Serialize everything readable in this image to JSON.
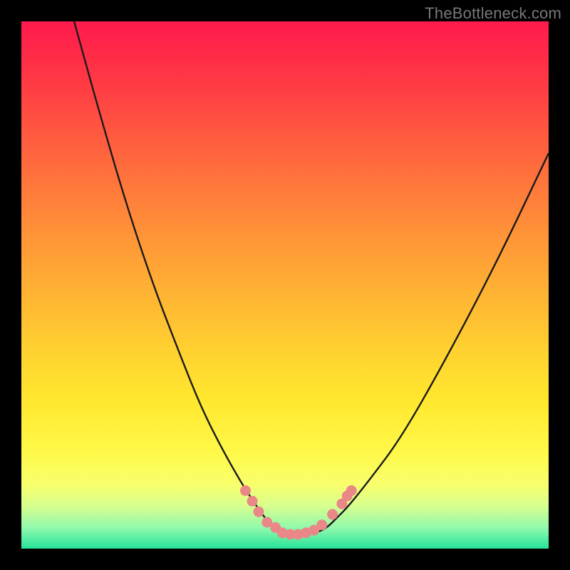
{
  "watermark": "TheBottleneck.com",
  "colors": {
    "frame": "#000000",
    "curve_stroke": "#1a1a1a",
    "marker_fill": "#e98886",
    "gradient_top": "#ff1a4d",
    "gradient_bottom": "#25e49a"
  },
  "chart_data": {
    "type": "line",
    "title": "",
    "xlabel": "",
    "ylabel": "",
    "xlim": [
      0,
      100
    ],
    "ylim": [
      0,
      100
    ],
    "grid": false,
    "legend": false,
    "note": "Y axis is inverted visually (0 at top, 100 at bottom). Values below are data-space y where higher = lower on screen (closer to green).",
    "series": [
      {
        "name": "curve",
        "x": [
          10,
          15,
          20,
          25,
          30,
          34,
          38,
          42,
          44,
          46,
          48,
          50,
          52,
          54,
          56,
          58,
          60,
          62,
          66,
          72,
          80,
          90,
          100
        ],
        "y": [
          0,
          18,
          35,
          50,
          63,
          73,
          81,
          88,
          91,
          94,
          96,
          97,
          97,
          97,
          97,
          96,
          94,
          92,
          87,
          79,
          65,
          46,
          25
        ]
      }
    ],
    "markers": [
      {
        "x": 42.5,
        "y": 89
      },
      {
        "x": 43.8,
        "y": 91
      },
      {
        "x": 45.0,
        "y": 93
      },
      {
        "x": 46.6,
        "y": 95
      },
      {
        "x": 48.2,
        "y": 96
      },
      {
        "x": 49.5,
        "y": 97
      },
      {
        "x": 51.0,
        "y": 97.3
      },
      {
        "x": 52.5,
        "y": 97.3
      },
      {
        "x": 54.0,
        "y": 97
      },
      {
        "x": 55.5,
        "y": 96.5
      },
      {
        "x": 57.0,
        "y": 95.5
      },
      {
        "x": 59.0,
        "y": 93.5
      },
      {
        "x": 60.8,
        "y": 91.5
      },
      {
        "x": 61.8,
        "y": 90
      },
      {
        "x": 62.6,
        "y": 89
      }
    ]
  }
}
